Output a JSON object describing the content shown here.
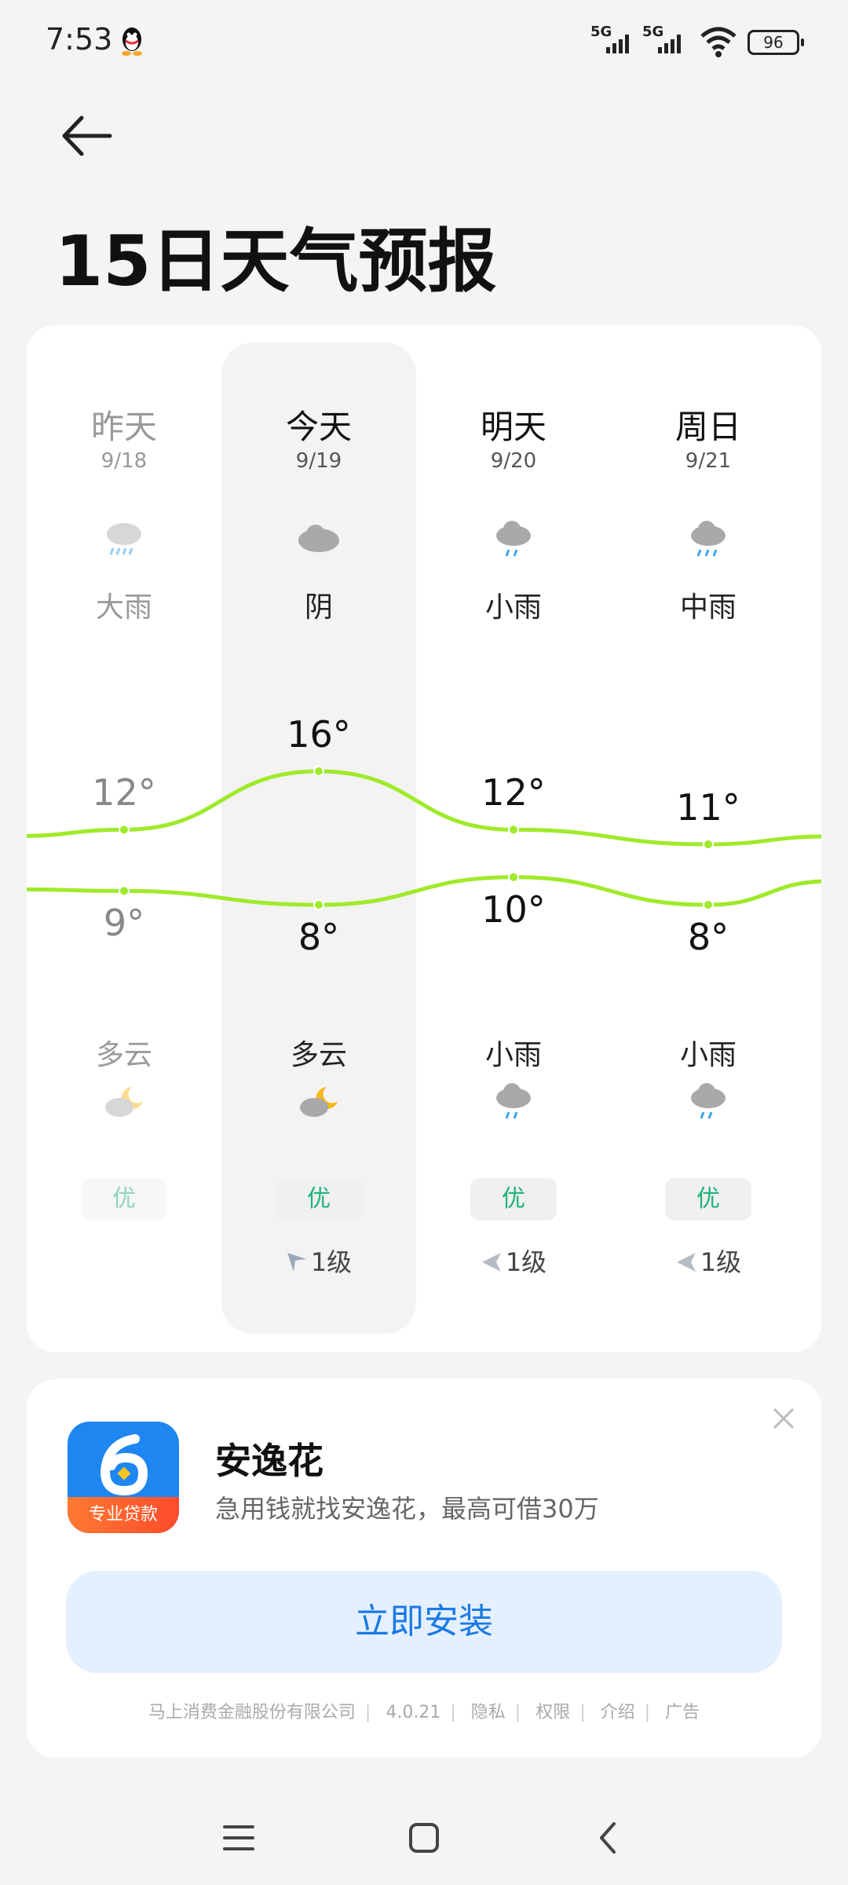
{
  "status": {
    "time": "7:53",
    "signal1": "5G",
    "signal2": "5G",
    "battery": "96"
  },
  "title": "15日天气预报",
  "days": [
    {
      "name": "昨天",
      "date": "9/18",
      "day_condition": "大雨",
      "day_icon": "heavy-rain-icon",
      "high": "12°",
      "low": "9°",
      "night_condition": "多云",
      "night_icon": "partly-cloudy-night-icon",
      "aqi": "优",
      "wind": ""
    },
    {
      "name": "今天",
      "date": "9/19",
      "day_condition": "阴",
      "day_icon": "overcast-icon",
      "high": "16°",
      "low": "8°",
      "night_condition": "多云",
      "night_icon": "partly-cloudy-night-icon",
      "aqi": "优",
      "wind": "1级"
    },
    {
      "name": "明天",
      "date": "9/20",
      "day_condition": "小雨",
      "day_icon": "light-rain-icon",
      "high": "12°",
      "low": "10°",
      "night_condition": "小雨",
      "night_icon": "light-rain-icon",
      "aqi": "优",
      "wind": "1级"
    },
    {
      "name": "周日",
      "date": "9/21",
      "day_condition": "中雨",
      "day_icon": "moderate-rain-icon",
      "high": "11°",
      "low": "8°",
      "night_condition": "小雨",
      "night_icon": "light-rain-icon",
      "aqi": "优",
      "wind": "1级"
    }
  ],
  "colors": {
    "curve": "#9fea2a",
    "aqi_good": "#1fb37a",
    "install_text": "#1a7ae6"
  },
  "ad": {
    "name": "安逸花",
    "description": "急用钱就找安逸花，最高可借30万",
    "logo_tag": "专业贷款",
    "install_label": "立即安装",
    "footer": [
      "马上消费金融股份有限公司",
      "4.0.21",
      "隐私",
      "权限",
      "介绍",
      "广告"
    ]
  }
}
